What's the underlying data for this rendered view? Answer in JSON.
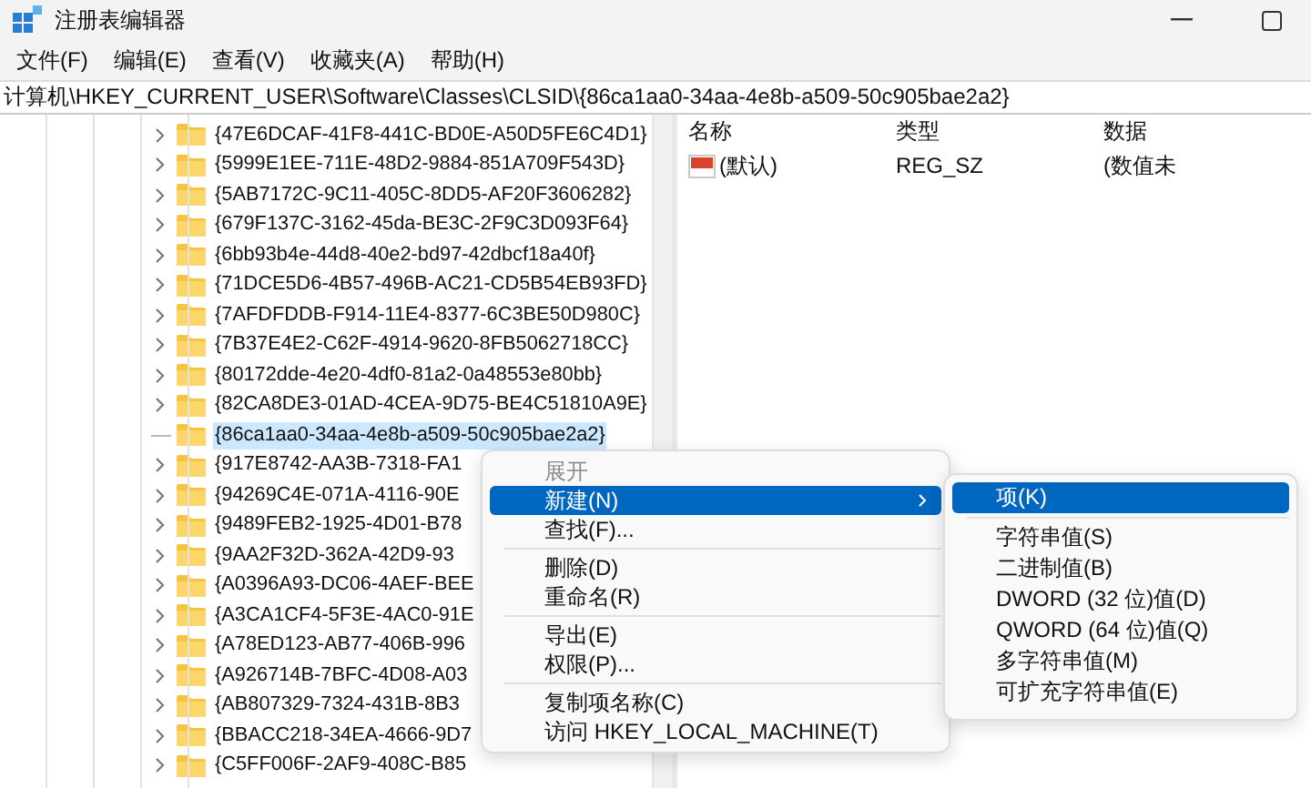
{
  "window": {
    "title": "注册表编辑器"
  },
  "menu_bar": [
    "文件(F)",
    "编辑(E)",
    "查看(V)",
    "收藏夹(A)",
    "帮助(H)"
  ],
  "address": "计算机\\HKEY_CURRENT_USER\\Software\\Classes\\CLSID\\{86ca1aa0-34aa-4e8b-a509-50c905bae2a2}",
  "tree": [
    {
      "label": "{47E6DCAF-41F8-441C-BD0E-A50D5FE6C4D1}",
      "expandable": true,
      "selected": false
    },
    {
      "label": "{5999E1EE-711E-48D2-9884-851A709F543D}",
      "expandable": true,
      "selected": false
    },
    {
      "label": "{5AB7172C-9C11-405C-8DD5-AF20F3606282}",
      "expandable": true,
      "selected": false
    },
    {
      "label": "{679F137C-3162-45da-BE3C-2F9C3D093F64}",
      "expandable": true,
      "selected": false
    },
    {
      "label": "{6bb93b4e-44d8-40e2-bd97-42dbcf18a40f}",
      "expandable": true,
      "selected": false
    },
    {
      "label": "{71DCE5D6-4B57-496B-AC21-CD5B54EB93FD}",
      "expandable": true,
      "selected": false
    },
    {
      "label": "{7AFDFDDB-F914-11E4-8377-6C3BE50D980C}",
      "expandable": true,
      "selected": false
    },
    {
      "label": "{7B37E4E2-C62F-4914-9620-8FB5062718CC}",
      "expandable": true,
      "selected": false
    },
    {
      "label": "{80172dde-4e20-4df0-81a2-0a48553e80bb}",
      "expandable": true,
      "selected": false
    },
    {
      "label": "{82CA8DE3-01AD-4CEA-9D75-BE4C51810A9E}",
      "expandable": true,
      "selected": false
    },
    {
      "label": "{86ca1aa0-34aa-4e8b-a509-50c905bae2a2}",
      "expandable": false,
      "selected": true
    },
    {
      "label": "{917E8742-AA3B-7318-FA1",
      "expandable": true,
      "selected": false
    },
    {
      "label": "{94269C4E-071A-4116-90E",
      "expandable": true,
      "selected": false
    },
    {
      "label": "{9489FEB2-1925-4D01-B78",
      "expandable": true,
      "selected": false
    },
    {
      "label": "{9AA2F32D-362A-42D9-93",
      "expandable": true,
      "selected": false
    },
    {
      "label": "{A0396A93-DC06-4AEF-BEE",
      "expandable": true,
      "selected": false
    },
    {
      "label": "{A3CA1CF4-5F3E-4AC0-91E",
      "expandable": true,
      "selected": false
    },
    {
      "label": "{A78ED123-AB77-406B-996",
      "expandable": true,
      "selected": false
    },
    {
      "label": "{A926714B-7BFC-4D08-A03",
      "expandable": true,
      "selected": false
    },
    {
      "label": "{AB807329-7324-431B-8B3",
      "expandable": true,
      "selected": false
    },
    {
      "label": "{BBACC218-34EA-4666-9D7",
      "expandable": true,
      "selected": false
    },
    {
      "label": "{C5FF006F-2AF9-408C-B85",
      "expandable": true,
      "selected": false
    }
  ],
  "values": {
    "columns": [
      "名称",
      "类型",
      "数据"
    ],
    "rows": [
      {
        "name": "(默认)",
        "type": "REG_SZ",
        "data": "(数值未"
      }
    ]
  },
  "context_menu": [
    {
      "kind": "item",
      "label": "展开",
      "disabled": true,
      "selected": false,
      "submenu": false
    },
    {
      "kind": "item",
      "label": "新建(N)",
      "disabled": false,
      "selected": true,
      "submenu": true
    },
    {
      "kind": "item",
      "label": "查找(F)...",
      "disabled": false,
      "selected": false,
      "submenu": false
    },
    {
      "kind": "separator"
    },
    {
      "kind": "item",
      "label": "删除(D)",
      "disabled": false,
      "selected": false,
      "submenu": false
    },
    {
      "kind": "item",
      "label": "重命名(R)",
      "disabled": false,
      "selected": false,
      "submenu": false
    },
    {
      "kind": "separator"
    },
    {
      "kind": "item",
      "label": "导出(E)",
      "disabled": false,
      "selected": false,
      "submenu": false
    },
    {
      "kind": "item",
      "label": "权限(P)...",
      "disabled": false,
      "selected": false,
      "submenu": false
    },
    {
      "kind": "separator"
    },
    {
      "kind": "item",
      "label": "复制项名称(C)",
      "disabled": false,
      "selected": false,
      "submenu": false
    },
    {
      "kind": "item",
      "label": "访问 HKEY_LOCAL_MACHINE(T)",
      "disabled": false,
      "selected": false,
      "submenu": false
    }
  ],
  "submenu": [
    {
      "kind": "item",
      "label": "项(K)",
      "selected": true
    },
    {
      "kind": "separator"
    },
    {
      "kind": "item",
      "label": "字符串值(S)",
      "selected": false
    },
    {
      "kind": "item",
      "label": "二进制值(B)",
      "selected": false
    },
    {
      "kind": "item",
      "label": "DWORD (32 位)值(D)",
      "selected": false
    },
    {
      "kind": "item",
      "label": "QWORD (64 位)值(Q)",
      "selected": false
    },
    {
      "kind": "item",
      "label": "多字符串值(M)",
      "selected": false
    },
    {
      "kind": "item",
      "label": "可扩充字符串值(E)",
      "selected": false
    }
  ]
}
